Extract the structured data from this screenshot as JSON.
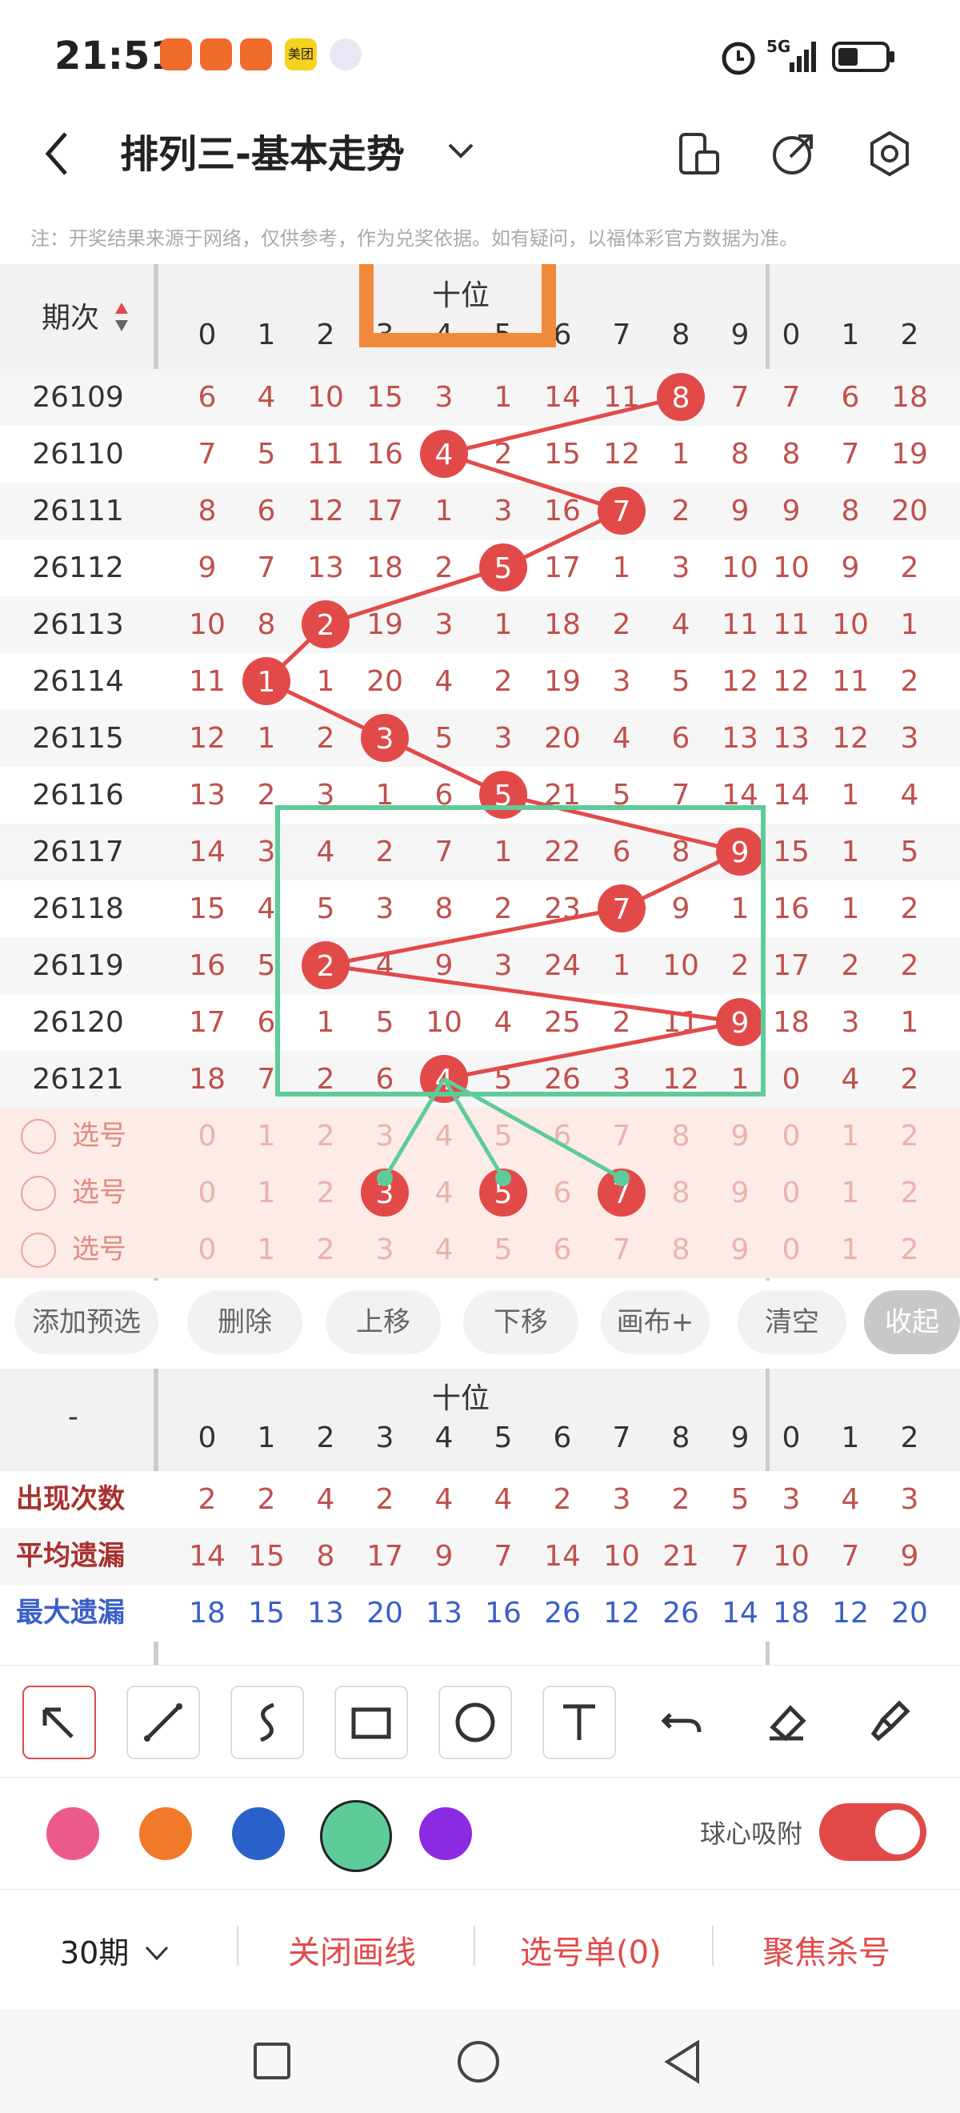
{
  "status": {
    "time": "21:51",
    "network": "5G",
    "app_icons": [
      "app-icon-red-1",
      "app-icon-red-2",
      "app-icon-red-3",
      "meituan-icon",
      "ball-app-icon"
    ],
    "meituan_label": "美团"
  },
  "header": {
    "title": "排列三-基本走势",
    "dropdown_icon": "chevron-down-icon"
  },
  "note": "注：开奖结果来源于网络，仅供参考，作为兑奖依据。如有疑问，以福体彩官方数据为准。",
  "table": {
    "issue_header": "期次",
    "section_label": "十位",
    "digits": [
      "0",
      "1",
      "2",
      "3",
      "4",
      "5",
      "6",
      "7",
      "8",
      "9"
    ],
    "next_digits": [
      "0",
      "1",
      "2"
    ],
    "rows": [
      {
        "issue": "26109",
        "values": [
          "6",
          "4",
          "10",
          "15",
          "3",
          "1",
          "14",
          "11",
          "8",
          "7"
        ],
        "next": [
          "7",
          "6",
          "18"
        ],
        "hit": 8
      },
      {
        "issue": "26110",
        "values": [
          "7",
          "5",
          "11",
          "16",
          "4",
          "2",
          "15",
          "12",
          "1",
          "8"
        ],
        "next": [
          "8",
          "7",
          "19"
        ],
        "hit": 4
      },
      {
        "issue": "26111",
        "values": [
          "8",
          "6",
          "12",
          "17",
          "1",
          "3",
          "16",
          "7",
          "2",
          "9"
        ],
        "next": [
          "9",
          "8",
          "20"
        ],
        "hit": 7
      },
      {
        "issue": "26112",
        "values": [
          "9",
          "7",
          "13",
          "18",
          "2",
          "5",
          "17",
          "1",
          "3",
          "10"
        ],
        "next": [
          "10",
          "9",
          "2"
        ],
        "hit": 5
      },
      {
        "issue": "26113",
        "values": [
          "10",
          "8",
          "2",
          "19",
          "3",
          "1",
          "18",
          "2",
          "4",
          "11"
        ],
        "next": [
          "11",
          "10",
          "1"
        ],
        "hit": 2
      },
      {
        "issue": "26114",
        "values": [
          "11",
          "1",
          "1",
          "20",
          "4",
          "2",
          "19",
          "3",
          "5",
          "12"
        ],
        "next": [
          "12",
          "11",
          "2"
        ],
        "hit": 1
      },
      {
        "issue": "26115",
        "values": [
          "12",
          "1",
          "2",
          "3",
          "5",
          "3",
          "20",
          "4",
          "6",
          "13"
        ],
        "next": [
          "13",
          "12",
          "3"
        ],
        "hit": 3
      },
      {
        "issue": "26116",
        "values": [
          "13",
          "2",
          "3",
          "1",
          "6",
          "5",
          "21",
          "5",
          "7",
          "14"
        ],
        "next": [
          "14",
          "1",
          "4"
        ],
        "hit": 5
      },
      {
        "issue": "26117",
        "values": [
          "14",
          "3",
          "4",
          "2",
          "7",
          "1",
          "22",
          "6",
          "8",
          "9"
        ],
        "next": [
          "15",
          "1",
          "5"
        ],
        "hit": 9
      },
      {
        "issue": "26118",
        "values": [
          "15",
          "4",
          "5",
          "3",
          "8",
          "2",
          "23",
          "7",
          "9",
          "1"
        ],
        "next": [
          "16",
          "1",
          "2"
        ],
        "hit": 7
      },
      {
        "issue": "26119",
        "values": [
          "16",
          "5",
          "2",
          "4",
          "9",
          "3",
          "24",
          "1",
          "10",
          "2"
        ],
        "next": [
          "17",
          "2",
          "2"
        ],
        "hit": 2
      },
      {
        "issue": "26120",
        "values": [
          "17",
          "6",
          "1",
          "5",
          "10",
          "4",
          "25",
          "2",
          "11",
          "9"
        ],
        "next": [
          "18",
          "3",
          "1"
        ],
        "hit": 9
      },
      {
        "issue": "26121",
        "values": [
          "18",
          "7",
          "2",
          "6",
          "4",
          "5",
          "26",
          "3",
          "12",
          "1"
        ],
        "next": [
          "0",
          "4",
          "2"
        ],
        "hit": 4
      }
    ],
    "pick_label": "选号",
    "pick_rows": [
      {
        "selected": []
      },
      {
        "selected": [
          3,
          5,
          7
        ]
      },
      {
        "selected": []
      }
    ]
  },
  "actions": [
    "添加预选",
    "删除",
    "上移",
    "下移",
    "画布+",
    "清空",
    "收起"
  ],
  "stats": {
    "dash": "-",
    "section_label": "十位",
    "rows": [
      {
        "label": "出现次数",
        "values": [
          "2",
          "2",
          "4",
          "2",
          "4",
          "4",
          "2",
          "3",
          "2",
          "5"
        ],
        "next": [
          "3",
          "4",
          "3"
        ]
      },
      {
        "label": "平均遗漏",
        "values": [
          "14",
          "15",
          "8",
          "17",
          "9",
          "7",
          "14",
          "10",
          "21",
          "7"
        ],
        "next": [
          "10",
          "7",
          "9"
        ]
      },
      {
        "label": "最大遗漏",
        "values": [
          "18",
          "15",
          "13",
          "20",
          "13",
          "16",
          "26",
          "12",
          "26",
          "14"
        ],
        "next": [
          "18",
          "12",
          "20"
        ]
      }
    ]
  },
  "tools": [
    "select-arrow-icon",
    "line-icon",
    "freehand-icon",
    "rectangle-icon",
    "circle-icon",
    "text-icon",
    "undo-icon",
    "eraser-icon",
    "clear-brush-icon"
  ],
  "colors": [
    "#ec5a8c",
    "#f07a2a",
    "#2a62c9",
    "#5ecc98",
    "#8a2be2"
  ],
  "snap_label": "球心吸附",
  "bottom": {
    "period": "30期",
    "close_lines": "关闭画线",
    "pick_list": "选号单(0)",
    "focus_kill": "聚焦杀号"
  },
  "colors_theme": {
    "accent": "#e24a4a",
    "green_box": "#5ecc98",
    "orange_box": "#f08a3a",
    "blue_text": "#3a5fc9"
  }
}
